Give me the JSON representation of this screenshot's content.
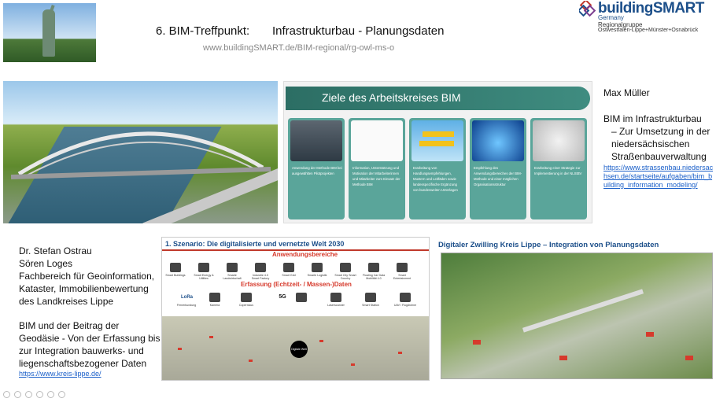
{
  "header": {
    "title_number": "6. BIM-Treffpunkt:",
    "title_topic": "Infrastrukturbau - Planungsdaten",
    "url": "www.buildingSMART.de/BIM-regional/rg-owl-ms-o",
    "logo": {
      "brand": "buildingSMART",
      "country": "Germany",
      "region_line1": "Regionalgruppe",
      "region_line2": "Ostwestfalen-Lippe+Münster+Osnabrück"
    }
  },
  "ziele_slide": {
    "title": "Ziele des Arbeitskreises BIM",
    "cards": [
      {
        "text": "Anwendung der Methode BIM bei ausgewählten Pilotprojekten"
      },
      {
        "text": "Information, Unterstützung und Motivation der Mitarbeiterinnen und Mitarbeiter zum Einsatz der Methode BIM"
      },
      {
        "text": "Erarbeitung von Handlungsempfehlungen, Mustern und Leitfäden sowie landesspezifische Ergänzung von bundesweiten Unterlagen"
      },
      {
        "text": "Empfehlung des Anwendungsbereiches der BIM-Methode und einer möglichen Organisationsstruktur"
      },
      {
        "text": "Erarbeitung einer Strategie zur Implementierung in der NLStBV"
      }
    ]
  },
  "speaker_right": {
    "name": "Max Müller",
    "talk_line1": "BIM im Infrastrukturbau",
    "talk_line2": "– Zur Umsetzung in der",
    "talk_line3": "niedersächsischen",
    "talk_line4": "Straßenbauverwaltung",
    "link": "https://www.strassenbau.niedersachsen.de/startseite/aufgaben/bim_building_information_modeling/"
  },
  "speaker_left": {
    "name1": "Dr. Stefan Ostrau",
    "name2": "Sören Loges",
    "dept1": "Fachbereich für Geoinformation,",
    "dept2": "Kataster, Immobilienbewertung",
    "dept3": "des Landkreises Lippe",
    "talk1": "BIM und der Beitrag der",
    "talk2": "Geodäsie - Von der Erfassung bis",
    "talk3": "zur Integration bauwerks- und",
    "talk4": "liegenschaftsbezogener Daten",
    "link": "https://www.kreis-lippe.de/"
  },
  "szenario_slide": {
    "title": "1. Szenario: Die digitalisierte und vernetzte Welt 2030",
    "anwendung_label": "Anwendungsbereiche",
    "erfassung_label": "Erfassung (Echtzeit- / Massen-)Daten",
    "apps": [
      "Smart Buildings",
      "Smart Energy & Utilities",
      "Smarte Landwirtschaft",
      "Industrie 4.0 Smart Factory",
      "Smart Grid",
      "Smarte Logistik",
      "Smart City Smart Country",
      "Floating Car Data Mobilität 4.0",
      "Smart Entertainment"
    ],
    "sensors": [
      "Fernerkundung",
      "Kamera",
      "Copernicus",
      "5G",
      "",
      "Laserscanner",
      "Smart Station",
      "UAV / Flugdrohne"
    ],
    "logos": [
      "LoRa",
      "5G"
    ],
    "center_node": "Digitale Welt"
  },
  "zwilling_slide": {
    "title": "Digitaler Zwilling Kreis Lippe – Integration von Planungsdaten"
  }
}
